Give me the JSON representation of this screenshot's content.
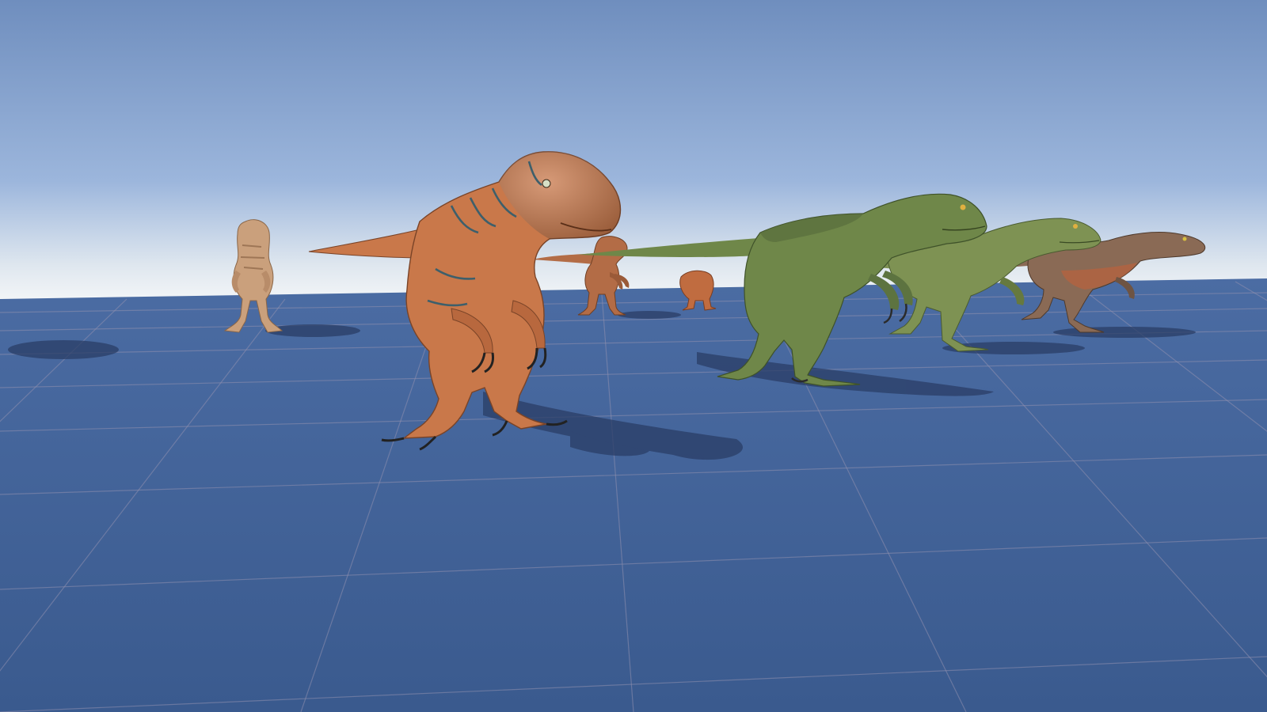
{
  "scene": {
    "colors": {
      "sky_top": "#6f8ebe",
      "sky_mid": "#9cb6dc",
      "horizon_glow": "#f4f6f8",
      "ground_near": "#3a5a8e",
      "ground_far": "#4b6ca3",
      "grid_line": "#8f8fae",
      "shadow": "#2a3d66"
    },
    "ground_grid": {
      "visible": true
    },
    "raptors": [
      {
        "id": "tan-far-left",
        "pose": "facing-camera",
        "skin": "#caa07c",
        "stripe": "#9e7656"
      },
      {
        "id": "orange-lead",
        "pose": "three-quarter-right",
        "skin": "#c9784a",
        "stripe": "#3d5f6b"
      },
      {
        "id": "orange-back",
        "pose": "facing-camera",
        "skin": "#b36c46",
        "stripe": "#7a4a2d"
      },
      {
        "id": "orange-small",
        "pose": "walking-right",
        "skin": "#c06c40",
        "stripe": "#7a3e22"
      },
      {
        "id": "green-front",
        "pose": "walking-right",
        "skin": "#6f8749",
        "stripe": "#4a6235"
      },
      {
        "id": "green-middle",
        "pose": "walking-right",
        "skin": "#7e9253",
        "stripe": "#56693a"
      },
      {
        "id": "brown-rear",
        "pose": "walking-right",
        "skin": "#8a6a55",
        "stripe": "#5b4434"
      }
    ]
  }
}
